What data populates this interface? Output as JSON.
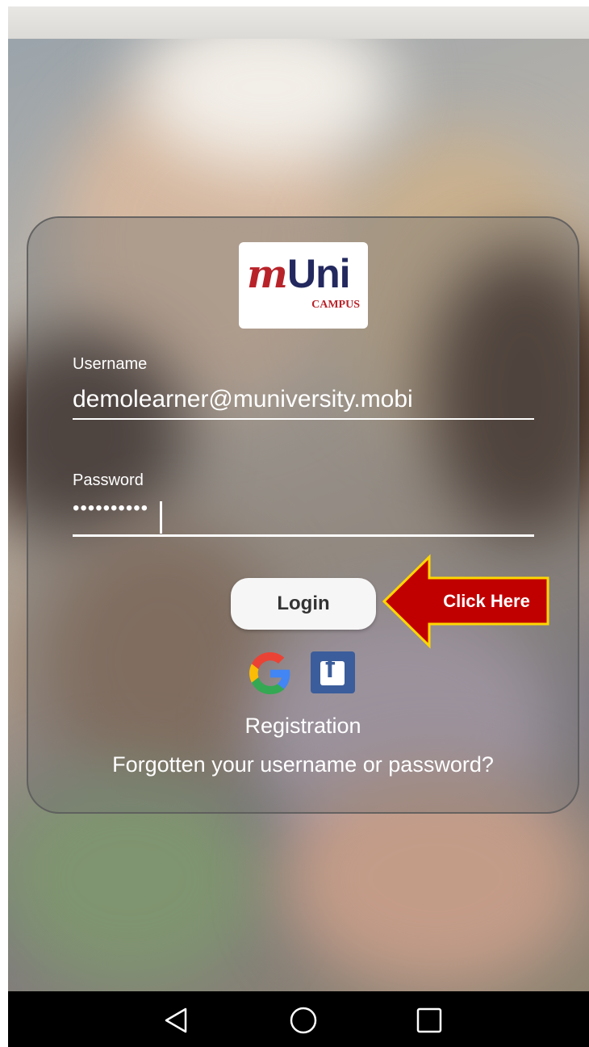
{
  "login": {
    "username_label": "Username",
    "username_value": "demolearner@muniversity.mobi",
    "password_label": "Password",
    "password_value": "••••••••••",
    "login_button": "Login"
  },
  "annotation": {
    "callout_text": "Click Here"
  },
  "links": {
    "registration": "Registration",
    "forgot": "Forgotten your username or password?"
  },
  "logo": {
    "mark": "m",
    "name": "Uni",
    "subtitle": "CAMPUS"
  },
  "icons": {
    "google": "google-icon",
    "facebook": "facebook-icon",
    "nav_back": "back-icon",
    "nav_home": "home-icon",
    "nav_recents": "recents-icon"
  },
  "colors": {
    "callout_fill": "#c00000",
    "callout_border": "#ffd700",
    "facebook_blue": "#3b5d9b",
    "logo_red": "#b8232a",
    "logo_navy": "#23295e"
  }
}
